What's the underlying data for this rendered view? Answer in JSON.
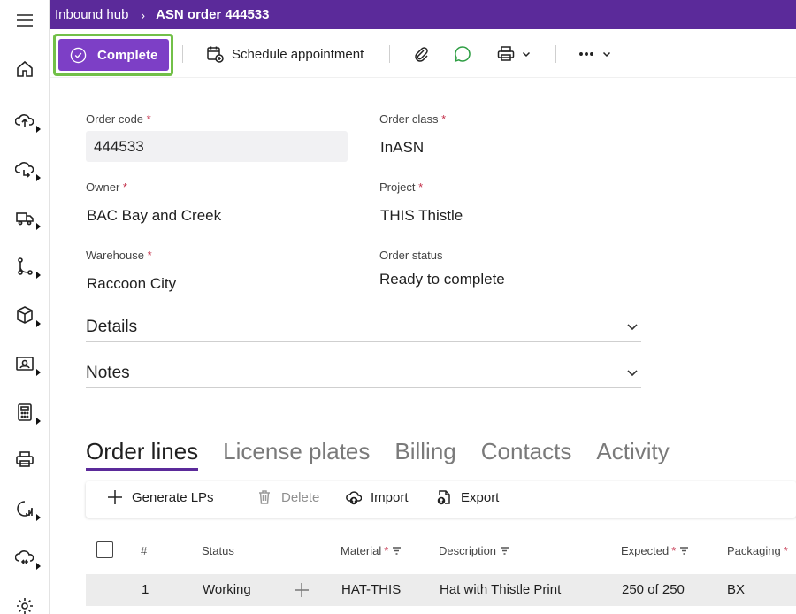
{
  "nav": {
    "icons": [
      "hamburger-icon",
      "home-icon",
      "upload-icon",
      "receive-icon",
      "truck-icon",
      "flow-icon",
      "box-icon",
      "contact-card-icon",
      "calculator-icon",
      "printer-icon",
      "chart-icon",
      "cloud-sync-icon",
      "settings-icon"
    ]
  },
  "breadcrumb": {
    "parent": "Inbound hub",
    "separator": "›",
    "current": "ASN order 444533"
  },
  "toolbar": {
    "complete_label": "Complete",
    "schedule_label": "Schedule appointment"
  },
  "form": {
    "order_code": {
      "label": "Order code",
      "req": "*",
      "value": "444533"
    },
    "order_class": {
      "label": "Order class",
      "req": "*",
      "value": "InASN"
    },
    "owner": {
      "label": "Owner",
      "req": "*",
      "value": "BAC Bay and Creek"
    },
    "project": {
      "label": "Project",
      "req": "*",
      "value": "THIS Thistle"
    },
    "warehouse": {
      "label": "Warehouse",
      "req": "*",
      "value": "Raccoon City"
    },
    "order_status": {
      "label": "Order status",
      "value": "Ready to complete"
    }
  },
  "sections": {
    "details": "Details",
    "notes": "Notes"
  },
  "tabs": [
    "Order lines",
    "License plates",
    "Billing",
    "Contacts",
    "Activity"
  ],
  "grid_toolbar": {
    "generate": "Generate LPs",
    "delete": "Delete",
    "import": "Import",
    "export": "Export"
  },
  "grid": {
    "headers": {
      "num": "#",
      "status": "Status",
      "material": "Material",
      "description": "Description",
      "expected": "Expected",
      "packaging": "Packaging",
      "req": "*"
    },
    "rows": [
      {
        "num": "1",
        "status": "Working",
        "material": "HAT-THIS",
        "description": "Hat with Thistle Print",
        "expected": "250 of 250",
        "packaging": "BX"
      }
    ]
  },
  "colors": {
    "topbar": "#5b2a9a",
    "primary_button": "#7d3fc6",
    "highlight_border": "#72c048",
    "required": "#c4314b"
  }
}
